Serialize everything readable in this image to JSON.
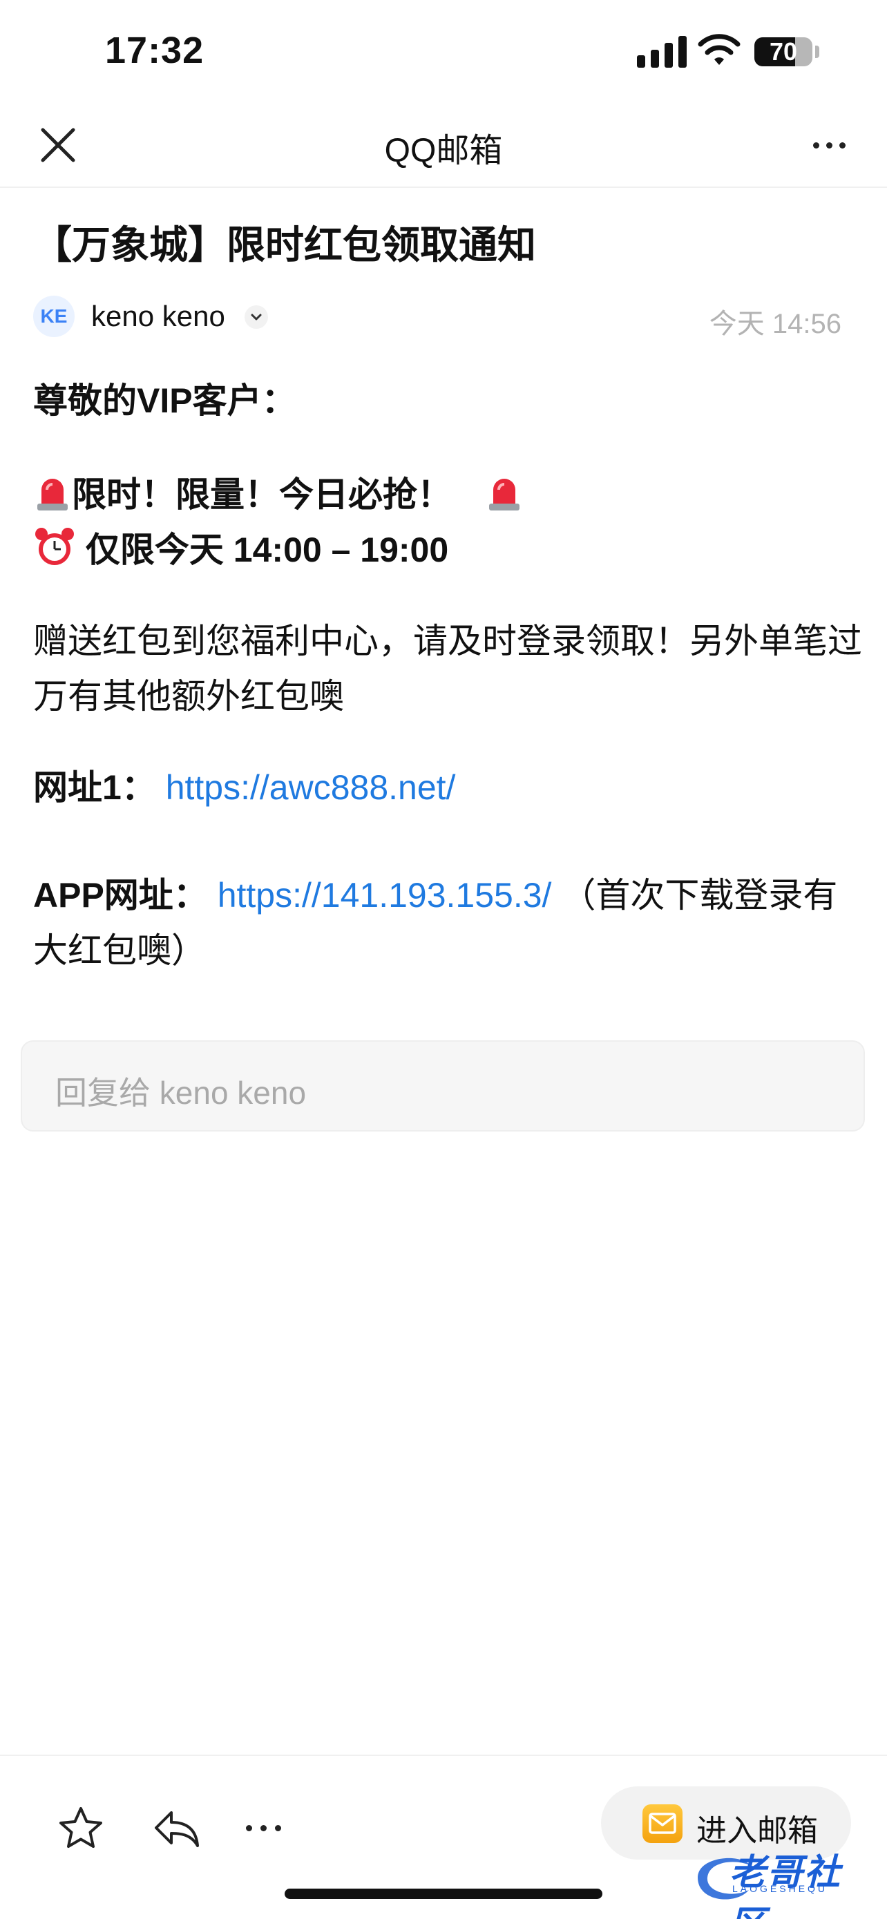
{
  "status_bar": {
    "time": "17:32",
    "battery": "70",
    "battery_level": 0.7
  },
  "nav": {
    "title": "QQ邮箱",
    "close_icon": "close-icon",
    "more_icon": "more-icon"
  },
  "email": {
    "subject": "【万象城】限时红包领取通知",
    "sender": {
      "avatar_initials": "KE",
      "name": "keno keno"
    },
    "time": "今天 14:56",
    "greeting": "尊敬的VIP客户：",
    "promo_line1": "限时！限量！今日必抢！",
    "promo_line2": "仅限今天 14:00 – 19:00",
    "paragraph": "赠送红包到您福利中心，请及时登录领取！另外单笔过万有其他额外红包噢",
    "link1_label": "网址1：",
    "link1_url": "https://awc888.net/",
    "app_label": "APP网址：",
    "app_url": "https://141.193.155.3/",
    "app_note": "（首次下载登录有大红包噢）"
  },
  "reply": {
    "placeholder": "回复给 keno keno"
  },
  "bottom_bar": {
    "enter_mailbox": "进入邮箱",
    "icons": [
      "star-icon",
      "reply-icon",
      "more-icon",
      "mail-icon"
    ]
  },
  "watermark": {
    "text": "老哥社区",
    "sub": "LAOGESHEQU"
  },
  "colors": {
    "link": "#1f7ae0",
    "muted": "#b3b3b3",
    "avatar_bg": "#eaf2ff",
    "mail_icon": "#f4a20f"
  }
}
